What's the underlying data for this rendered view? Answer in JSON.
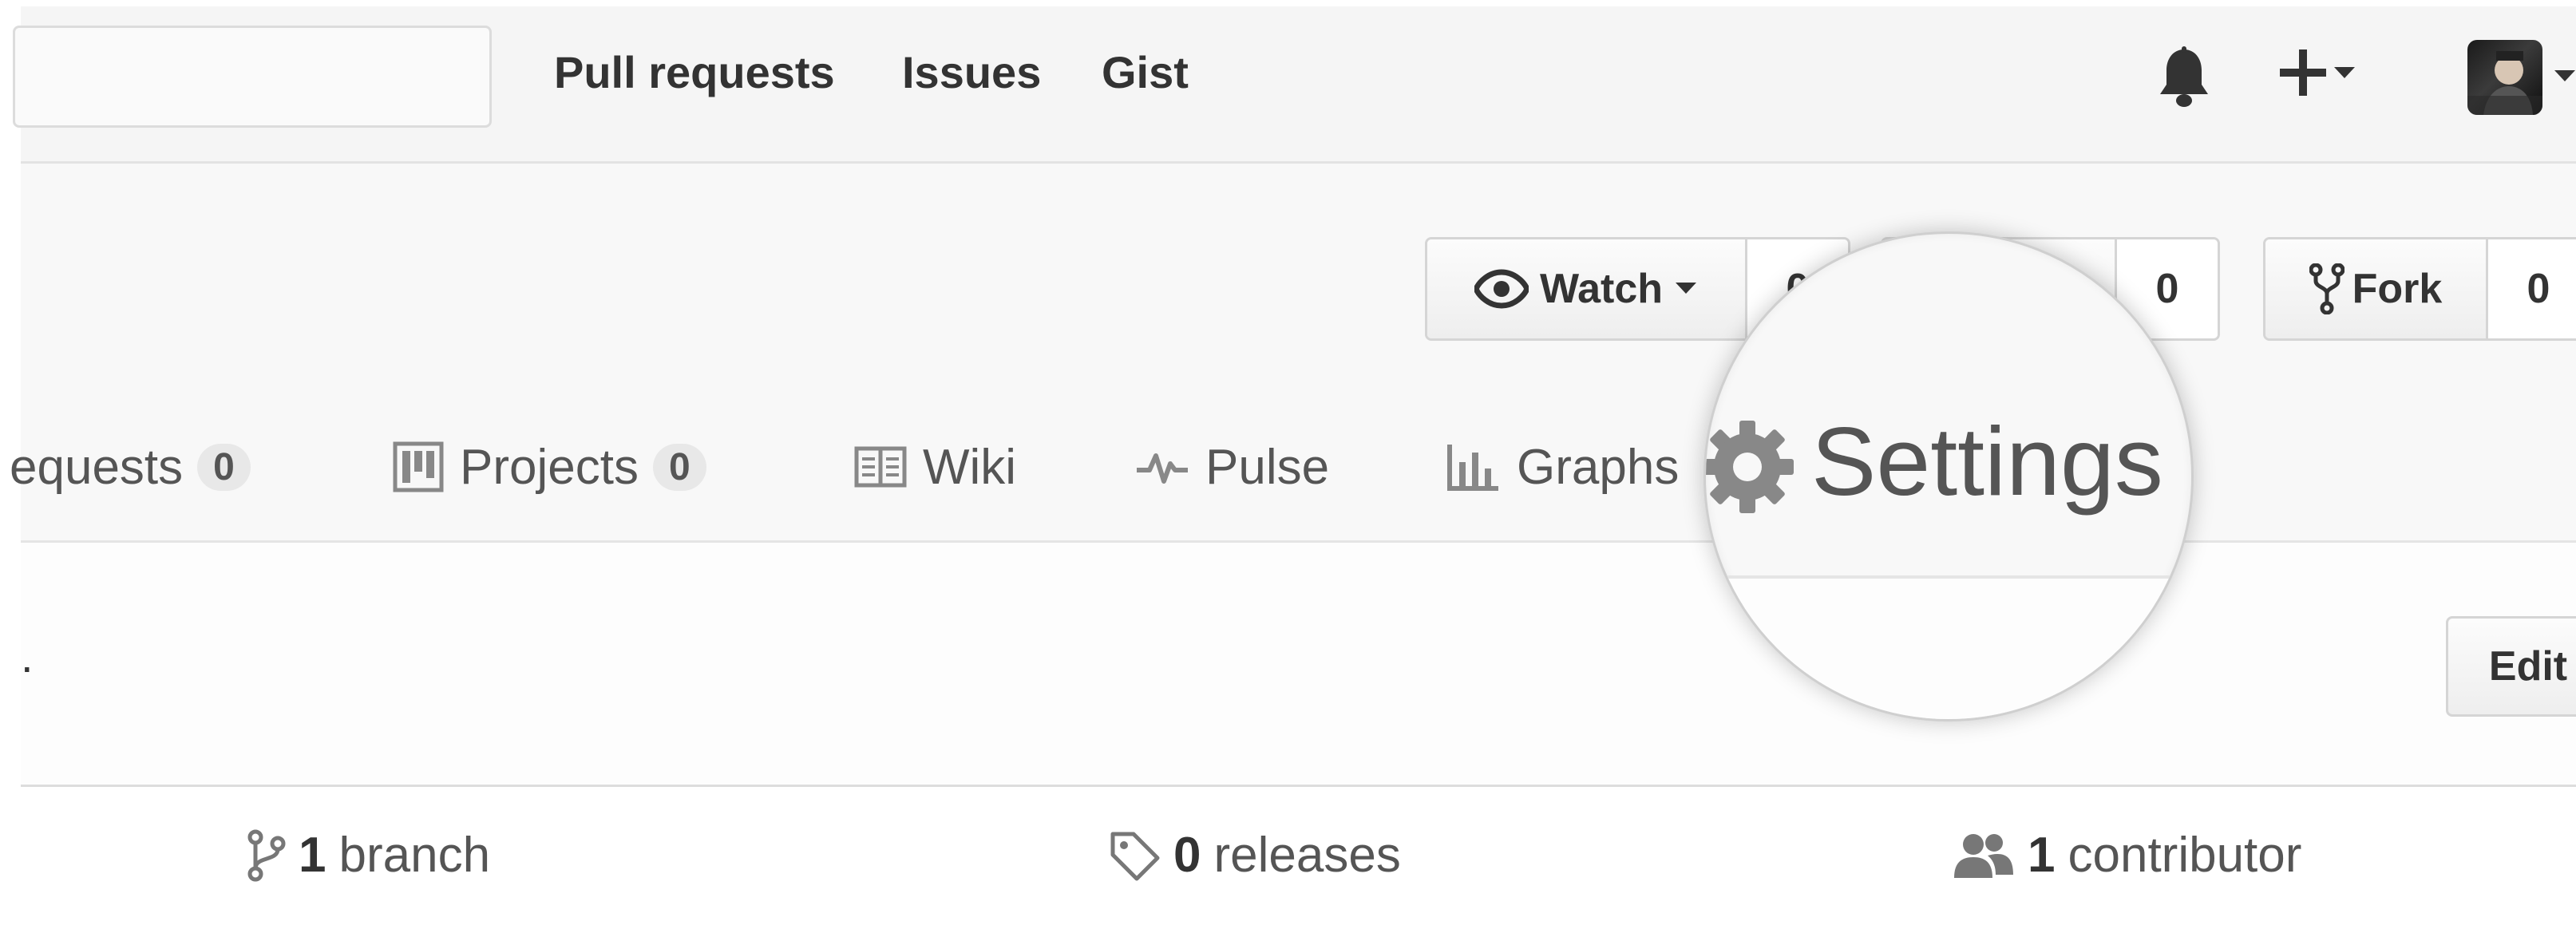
{
  "header": {
    "nav": [
      "Pull requests",
      "Issues",
      "Gist"
    ]
  },
  "repo_actions": {
    "watch": {
      "label": "Watch",
      "count": "0"
    },
    "star": {
      "count": "0"
    },
    "fork": {
      "label": "Fork",
      "count": "0"
    }
  },
  "tabs": [
    {
      "label": "equests",
      "count": "0"
    },
    {
      "label": "Projects",
      "count": "0"
    },
    {
      "label": "Wiki"
    },
    {
      "label": "Pulse"
    },
    {
      "label": "Graphs"
    },
    {
      "label": "Settings"
    }
  ],
  "description": {
    "text": ".",
    "edit_label": "Edit"
  },
  "summary": {
    "branch": {
      "num": "1",
      "label": "branch"
    },
    "releases": {
      "num": "0",
      "label": "releases"
    },
    "contributor": {
      "num": "1",
      "label": "contributor"
    }
  },
  "icons": {
    "watch": "eye-icon",
    "fork": "fork-icon",
    "notifications": "bell-icon",
    "create": "plus-icon",
    "projects": "project-board-icon",
    "wiki": "book-icon",
    "pulse": "pulse-icon",
    "graphs": "graph-icon",
    "settings": "gear-icon",
    "branch": "branch-icon",
    "releases": "tag-icon",
    "contributors": "people-icon"
  }
}
